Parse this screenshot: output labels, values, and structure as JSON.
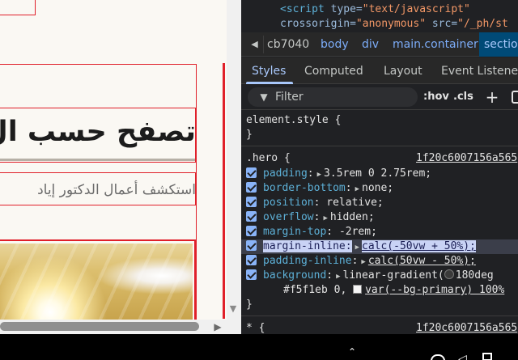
{
  "preview": {
    "heading": "تصفح حسب ال",
    "subtitle": "استكشف أعمال الدكتور إياد"
  },
  "source": {
    "line1_tag": "<script",
    "line1_attr": "type=",
    "line1_val": "\"text/javascript\"",
    "line2_attr": "crossorigin=",
    "line2_val": "\"anonymous\"",
    "line2_attr2": "src=",
    "line2_val2": "\"/_ph/st"
  },
  "breadcrumb": {
    "back_icon": "chevron-left-icon",
    "items": [
      "cb7040",
      "body",
      "div",
      "main.container",
      "sectio"
    ]
  },
  "tabs": [
    "Styles",
    "Computed",
    "Layout",
    "Event Listener"
  ],
  "filter": {
    "placeholder": "Filter",
    "hov": ":hov",
    "cls": ".cls",
    "add": "+"
  },
  "styles": {
    "element_style_selector": "element.style {",
    "close_brace": "}",
    "hero_selector": ".hero {",
    "hero_source": "1f20c6007156a565",
    "hero_decls": [
      {
        "prop": "padding",
        "arrow": true,
        "value": "3.5rem 0 2.75rem;"
      },
      {
        "prop": "border-bottom",
        "arrow": true,
        "value": "none;"
      },
      {
        "prop": "position",
        "arrow": false,
        "value": "relative;"
      },
      {
        "prop": "overflow",
        "arrow": true,
        "value": "hidden;"
      },
      {
        "prop": "margin-top",
        "arrow": false,
        "value": "-2rem;"
      },
      {
        "prop": "margin-inline",
        "arrow": true,
        "value": "calc(-50vw + 50%);"
      },
      {
        "prop": "padding-inline",
        "arrow": true,
        "value": "calc(50vw - 50%);"
      },
      {
        "prop": "background",
        "arrow": true,
        "value": "linear-gradient(",
        "value2": "180deg"
      }
    ],
    "background_line2_a": "#f5f1eb 0,",
    "background_line2_b": "var(--bg-primary) 100%",
    "universal_selector": "* {",
    "universal_source": "1f20c6007156a565"
  },
  "colors": {
    "accent_blue": "#a8c7fa",
    "property_blue": "#5db0d7",
    "highlight": "#c9d3f5",
    "page_outline_red": "#e0202a"
  }
}
